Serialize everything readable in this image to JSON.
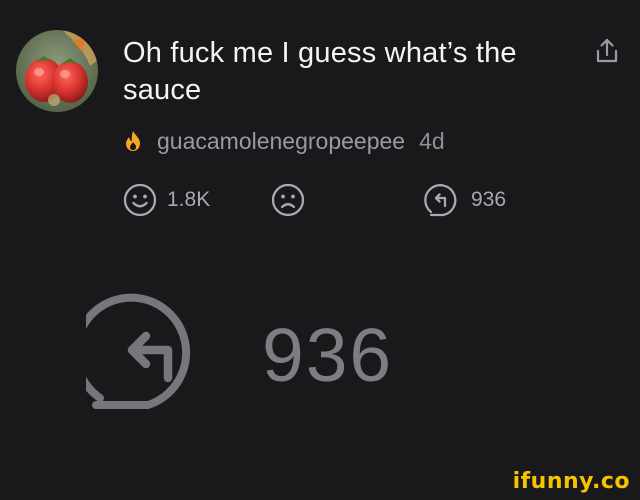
{
  "post": {
    "title": "Oh fuck me I guess what’s the sauce",
    "username": "guacamolenegropeepee",
    "age": "4d"
  },
  "icons": {
    "avatar": "avatar-image",
    "share": "share-icon",
    "flame": "flame-icon",
    "upvote": "smiley-icon",
    "downvote": "frown-icon",
    "repost": "repost-icon"
  },
  "reactions": {
    "likes": "1.8K",
    "reposts": "936"
  },
  "zoom": {
    "reposts": "936"
  },
  "watermark": "ifunny.co",
  "colors": {
    "background": "#19191b",
    "text": "#f4f4f6",
    "muted": "#8e8e93",
    "flame": "#f5a623",
    "watermark": "#f5c400"
  }
}
